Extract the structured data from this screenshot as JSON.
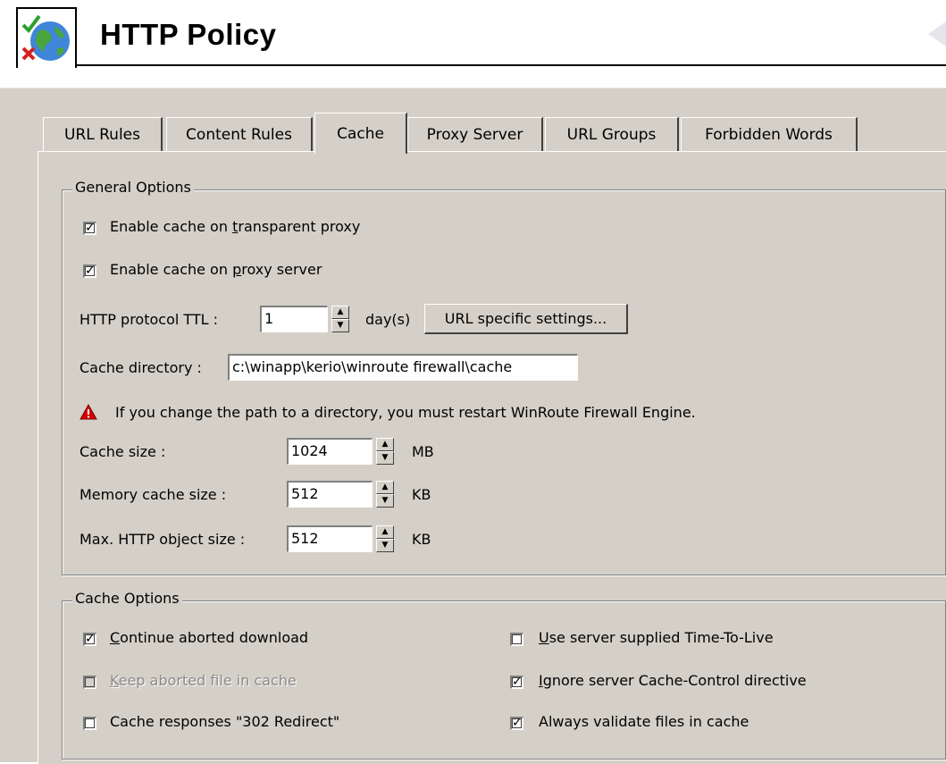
{
  "header": {
    "title": "HTTP Policy",
    "icon": "globe-check-icon"
  },
  "tabs": [
    {
      "label": "URL Rules"
    },
    {
      "label": "Content Rules"
    },
    {
      "label": "Cache",
      "active": true
    },
    {
      "label": "Proxy Server"
    },
    {
      "label": "URL Groups"
    },
    {
      "label": "Forbidden Words"
    }
  ],
  "general": {
    "title": "General Options",
    "transparent_cache": {
      "pre": "Enable cache on ",
      "mn": "t",
      "post": "ransparent proxy",
      "checked": true
    },
    "proxy_cache": {
      "pre": "Enable cache on ",
      "mn": "p",
      "post": "roxy server",
      "checked": true
    },
    "ttl_label": "HTTP protocol TTL :",
    "ttl_value": "1",
    "ttl_unit": "day(s)",
    "url_specific_button": "URL specific settings...",
    "cache_dir_label": "Cache directory :",
    "cache_dir_value": "c:\\winapp\\kerio\\winroute firewall\\cache",
    "warning": "If you change the path to a directory, you must restart WinRoute Firewall Engine.",
    "cache_size_label": "Cache size :",
    "cache_size_value": "1024",
    "cache_size_unit": "MB",
    "mem_cache_label": "Memory cache size :",
    "mem_cache_value": "512",
    "mem_cache_unit": "KB",
    "max_obj_label": "Max. HTTP object size :",
    "max_obj_value": "512",
    "max_obj_unit": "KB"
  },
  "cache_opts": {
    "title": "Cache Options",
    "continue_aborted": {
      "mn": "C",
      "post": "ontinue aborted download",
      "checked": true,
      "enabled": true
    },
    "keep_aborted": {
      "mn": "K",
      "post": "eep aborted file in cache",
      "checked": false,
      "enabled": false
    },
    "cache_302": {
      "label": "Cache responses \"302 Redirect\"",
      "checked": false,
      "enabled": true
    },
    "server_ttl": {
      "mn": "U",
      "post": "se server supplied Time-To-Live",
      "checked": false,
      "enabled": true
    },
    "ignore_cc": {
      "mn": "I",
      "post": "gnore server Cache-Control directive",
      "checked": true,
      "enabled": true
    },
    "always_validate": {
      "label": "Always validate files in cache",
      "checked": true,
      "enabled": true
    }
  },
  "colors": {
    "face": "#d4d0c8",
    "warning": "#d40000"
  }
}
